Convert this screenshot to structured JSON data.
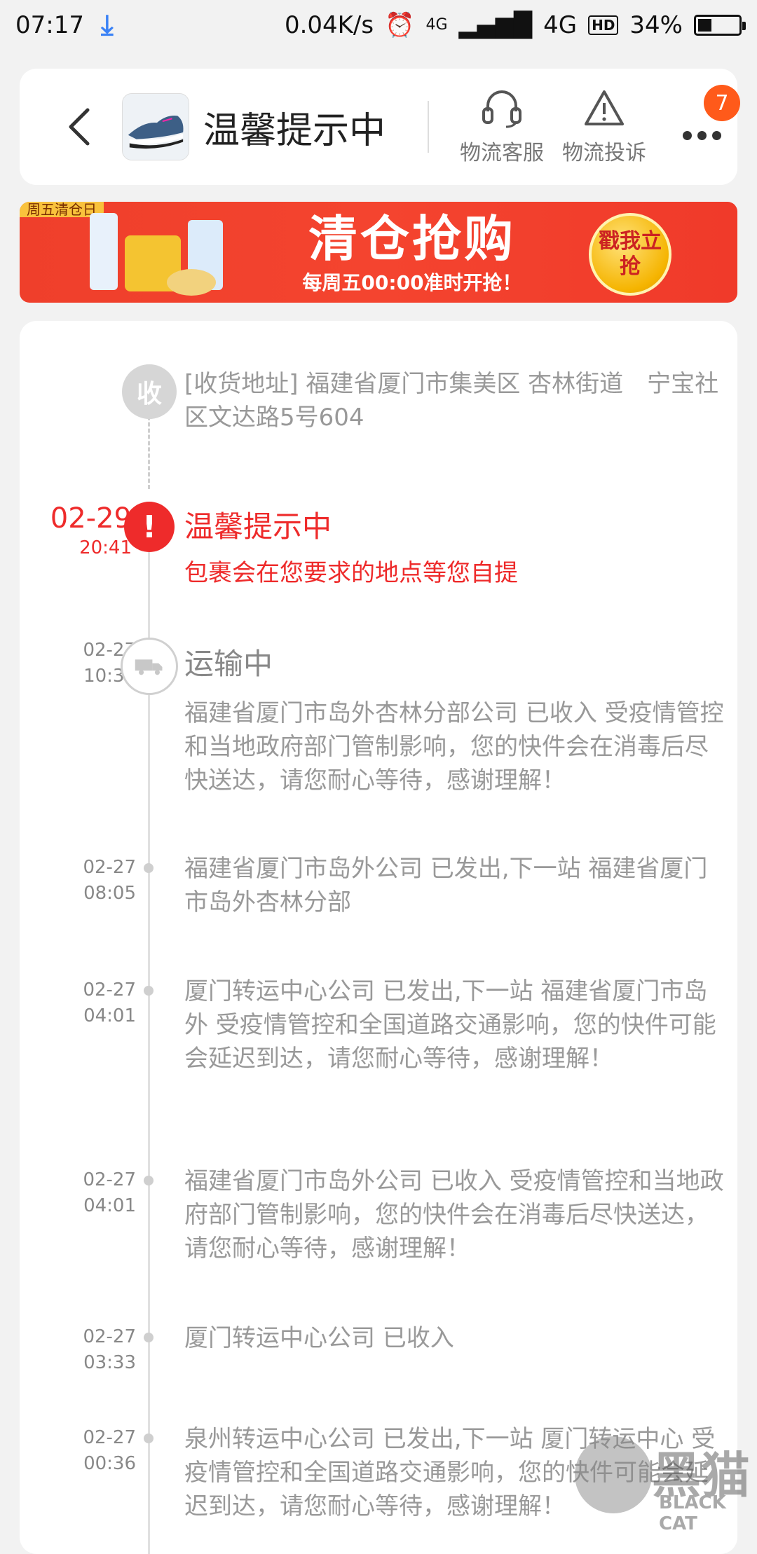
{
  "status_bar": {
    "time": "07:17",
    "net_speed": "0.04K/s",
    "signal_4g_small": "4G",
    "signal_4g": "4G",
    "hd": "HD",
    "battery": "34%",
    "battery_level": 0.34
  },
  "header": {
    "title": "温馨提示中",
    "service_label": "物流客服",
    "complaint_label": "物流投诉",
    "badge_count": "7"
  },
  "banner": {
    "tag": "周五清仓日",
    "headline": "清仓抢购",
    "subline": "每周五00:00准时开抢！",
    "cta": "戳我立抢"
  },
  "timeline": {
    "address": {
      "marker": "收",
      "text": "[收货地址] 福建省厦门市集美区 杏林街道　宁宝社区文达路5号604"
    },
    "current": {
      "date": "02-29",
      "time": "20:41",
      "marker": "!",
      "title": "温馨提示中",
      "text": "包裹会在您要求的地点等您自提"
    },
    "transit": {
      "date": "02-27",
      "time": "10:38",
      "title": "运输中",
      "text": "福建省厦门市岛外杏林分部公司 已收入 受疫情管控和当地政府部门管制影响，您的快件会在消毒后尽快送达，请您耐心等待，感谢理解！"
    },
    "events": [
      {
        "date": "02-27",
        "time": "08:05",
        "text": "福建省厦门市岛外公司 已发出,下一站 福建省厦门市岛外杏林分部"
      },
      {
        "date": "02-27",
        "time": "04:01",
        "text": "厦门转运中心公司 已发出,下一站 福建省厦门市岛外 受疫情管控和全国道路交通影响，您的快件可能会延迟到达，请您耐心等待，感谢理解！"
      },
      {
        "date": "02-27",
        "time": "04:01",
        "text": "福建省厦门市岛外公司 已收入 受疫情管控和当地政府部门管制影响，您的快件会在消毒后尽快送达，请您耐心等待，感谢理解！"
      },
      {
        "date": "02-27",
        "time": "03:33",
        "text": "厦门转运中心公司 已收入"
      },
      {
        "date": "02-27",
        "time": "00:36",
        "text": "泉州转运中心公司 已发出,下一站 厦门转运中心 受疫情管控和全国道路交通影响，您的快件可能会延迟到达，请您耐心等待，感谢理解！"
      }
    ]
  },
  "watermark": {
    "main": "黑猫",
    "sub": "BLACK CAT"
  }
}
